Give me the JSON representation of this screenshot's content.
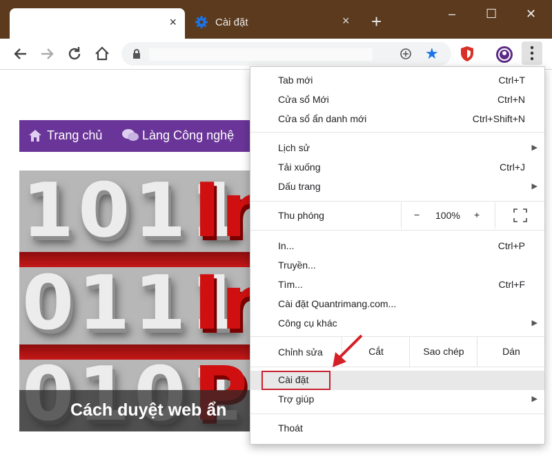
{
  "tabs": {
    "active": {
      "title": "",
      "close": "×"
    },
    "inactive": {
      "title": "Cài đặt",
      "close": "×"
    },
    "new_tab": "+"
  },
  "window_controls": {
    "minimize": "–",
    "maximize": "☐",
    "close": "✕"
  },
  "toolbar": {
    "url_value": ""
  },
  "site_nav": {
    "home": "Trang chủ",
    "tech": "Làng Công nghệ"
  },
  "hero": {
    "row1_digits": "1011",
    "row1_red": "In",
    "row2_digits": "0111",
    "row2_red": "In",
    "row3_digits": "0101",
    "row3_red": "Pr",
    "caption": "Cách duyệt web ẩn"
  },
  "menu": {
    "items": [
      {
        "label": "Tab mới",
        "shortcut": "Ctrl+T"
      },
      {
        "label": "Cửa sổ Mới",
        "shortcut": "Ctrl+N"
      },
      {
        "label": "Cửa sổ ẩn danh mới",
        "shortcut": "Ctrl+Shift+N"
      },
      {
        "label": "Lịch sử",
        "shortcut": ""
      },
      {
        "label": "Tải xuống",
        "shortcut": "Ctrl+J"
      },
      {
        "label": "Dấu trang",
        "shortcut": ""
      },
      {
        "label": "In...",
        "shortcut": "Ctrl+P"
      },
      {
        "label": "Truyền...",
        "shortcut": ""
      },
      {
        "label": "Tìm...",
        "shortcut": "Ctrl+F"
      },
      {
        "label": "Cài đặt Quantrimang.com...",
        "shortcut": ""
      },
      {
        "label": "Công cụ khác",
        "shortcut": ""
      },
      {
        "label": "Cài đặt",
        "shortcut": ""
      },
      {
        "label": "Trợ giúp",
        "shortcut": ""
      },
      {
        "label": "Thoát",
        "shortcut": ""
      }
    ],
    "zoom": {
      "label": "Thu phóng",
      "minus": "−",
      "value": "100%",
      "plus": "+"
    },
    "edit": {
      "label": "Chỉnh sửa",
      "cut": "Cắt",
      "copy": "Sao chép",
      "paste": "Dán"
    }
  },
  "colors": {
    "frame": "#5b3a1e",
    "site_nav": "#6a3598",
    "highlight_box": "#c6202e",
    "star": "#1a73e8"
  }
}
